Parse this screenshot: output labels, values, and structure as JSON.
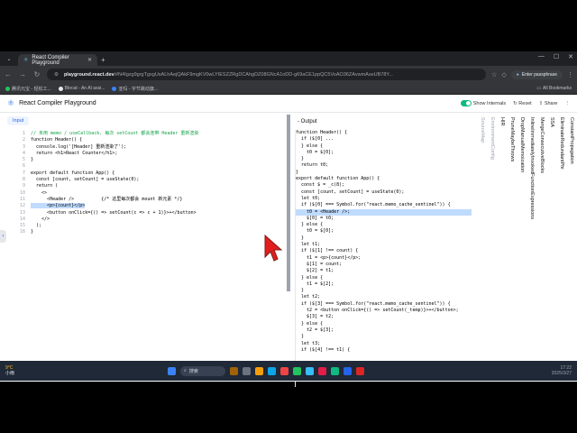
{
  "browser": {
    "tab_title": "React Compiler Playground",
    "url_host": "playground.react.dev",
    "url_path": "/#N4Igzg9grgTgxgUsALhAejQAkF9mgKV0wLYIESZZRgDCAhgDZ08GNcA1oDD-g69aCE1ppQC5VoAO36ZAvwmAseUB78Y...",
    "passphrase_label": "Enter passphrase",
    "bookmarks": [
      "腾讯元宝 - 轻松工...",
      "Bkrcat - An AI assi...",
      "亚玛 - 字节跳动旗..."
    ],
    "all_bookmarks": "All Bookmarks"
  },
  "app": {
    "title": "React Compiler Playground",
    "show_internals": "Show Internals",
    "reset": "Reset",
    "share": "Share"
  },
  "input": {
    "tab": "Input",
    "lines": [
      {
        "n": "1",
        "t": "// 未用 memo / useCallback, 每次 setCount 都会连带 Header 重新渲染",
        "c": "cm"
      },
      {
        "n": "2",
        "t": "function Header() {",
        "c": ""
      },
      {
        "n": "3",
        "t": "  console.log('[Header] 重新渲染了');",
        "c": ""
      },
      {
        "n": "4",
        "t": "  return <h1>React Counter</h1>;",
        "c": ""
      },
      {
        "n": "5",
        "t": "}",
        "c": ""
      },
      {
        "n": "6",
        "t": "",
        "c": ""
      },
      {
        "n": "7",
        "t": "export default function App() {",
        "c": ""
      },
      {
        "n": "8",
        "t": "  const [count, setCount] = useState(0);",
        "c": ""
      },
      {
        "n": "9",
        "t": "  return (",
        "c": ""
      },
      {
        "n": "10",
        "t": "    <>",
        "c": ""
      },
      {
        "n": "11",
        "t": "      <Header />          {/* 这里每次都会 mount 新元素 */}",
        "c": ""
      },
      {
        "n": "12",
        "t": "      <p>{count}</p>",
        "c": "hl"
      },
      {
        "n": "13",
        "t": "      <button onClick={() => setCount(c => c + 1)}>+</button>",
        "c": ""
      },
      {
        "n": "14",
        "t": "    </>",
        "c": ""
      },
      {
        "n": "15",
        "t": "  );",
        "c": ""
      },
      {
        "n": "16",
        "t": "}",
        "c": ""
      }
    ]
  },
  "output": {
    "header": "- Output",
    "lines": [
      "function Header() {",
      "  if ($[0] ...",
      "  } else {",
      "    t0 = $[0];",
      "  }",
      "  return t0;",
      "}",
      "",
      "export default function App() {",
      "  const $ = _c(8);",
      "  const [count, setCount] = useState(0);",
      "  let t0;",
      "  if ($[0] === Symbol.for(\"react.memo_cache_sentinel\")) {",
      "    t0 = <Header />;",
      "    $[0] = t0;",
      "  } else {",
      "    t0 = $[0];",
      "  }",
      "",
      "  let t1;",
      "  if ($[1] !== count) {",
      "    t1 = <p>{count}</p>;",
      "    $[1] = count;",
      "    $[2] = t1;",
      "  } else {",
      "    t1 = $[2];",
      "  }",
      "",
      "  let t2;",
      "  if ($[3] === Symbol.for(\"react.memo_cache_sentinel\")) {",
      "    t2 = <button onClick={() => setCount(_temp)}>+</button>;",
      "    $[3] = t2;",
      "  } else {",
      "    t2 = $[3];",
      "  }",
      "",
      "  let t3;",
      "  if ($[4] !== t1) {"
    ]
  },
  "passes": [
    {
      "label": "SourceMap",
      "dim": true
    },
    {
      "label": "EnvironmentConfig",
      "dim": true
    },
    {
      "label": "HIR",
      "dim": false
    },
    {
      "label": "PruneMaybeThrows",
      "dim": false
    },
    {
      "label": "DropManualMemoization",
      "dim": false
    },
    {
      "label": "InlineImmediatelyInvokedFunctionExpressions",
      "dim": false
    },
    {
      "label": "MergeConsecutiveBlocks",
      "dim": false
    },
    {
      "label": "SSA",
      "dim": false
    },
    {
      "label": "EliminateRedundantPhi",
      "dim": false
    },
    {
      "label": "ConstantPropagation",
      "dim": false
    }
  ],
  "taskbar": {
    "temp": "9°C",
    "weather": "小雨",
    "search": "搜索",
    "time": "17:22",
    "date": "2025/3/27"
  },
  "colors": {
    "accent": "#2563eb",
    "toggle_on": "#10b981"
  }
}
